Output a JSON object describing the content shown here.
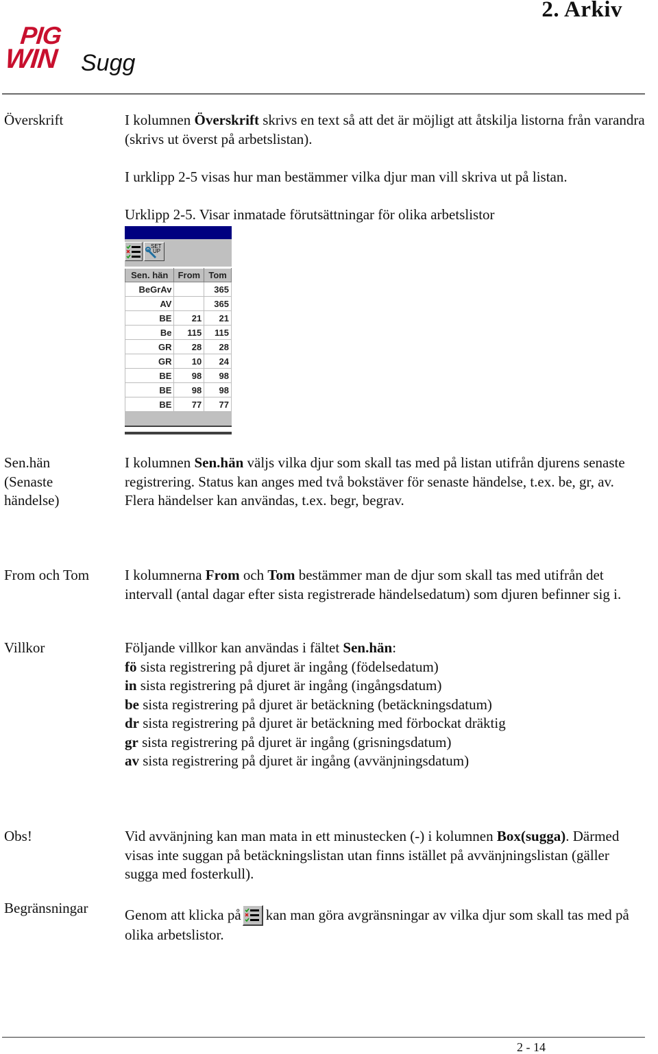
{
  "header": {
    "chapter_title": "2. Arkiv",
    "logo": {
      "line1": "PIG",
      "line2": "WIN",
      "product": "Sugg",
      "brand_color": "#c8102e"
    }
  },
  "sections": {
    "overskrift": {
      "label": "Överskrift",
      "para_pre": "I kolumnen ",
      "para_bold": "Överskrift",
      "para_post": " skrivs en text så att det är möjligt att åtskilja listorna från varandra (skrivs ut överst på arbetslistan).",
      "para2": "I urklipp 2-5 visas hur man bestämmer vilka djur man vill skriva ut på listan.",
      "caption": "Urklipp 2-5. Visar inmatade förutsättningar för olika arbetslistor"
    },
    "senhan": {
      "label_line1": "Sen.hän",
      "label_line2": "(Senaste",
      "label_line3": "händelse)",
      "para_pre": "I kolumnen ",
      "para_bold": "Sen.hän",
      "para_post": " väljs vilka djur som skall tas med på listan utifrån djurens senaste registrering. Status kan anges med två bokstäver för senaste händelse, t.ex. be, gr, av. Flera händelser kan användas, t.ex. begr, begrav."
    },
    "fromtom": {
      "label": "From och Tom",
      "para_pre": "I kolumnerna ",
      "bold1": "From",
      "mid": " och ",
      "bold2": "Tom",
      "para_post": " bestämmer man de djur som skall tas med utifrån det intervall (antal dagar efter sista registrerade händelsedatum) som djuren befinner sig i."
    },
    "villkor": {
      "label": "Villkor",
      "intro_pre": "Följande villkor kan användas i fältet ",
      "intro_bold": "Sen.hän",
      "intro_post": ":",
      "conditions": [
        {
          "code": "fö",
          "text": " sista registrering på djuret är ingång (födelsedatum)"
        },
        {
          "code": "in",
          "text": " sista registrering på djuret är ingång (ingångsdatum)"
        },
        {
          "code": "be",
          "text": " sista registrering på djuret är betäckning (betäckningsdatum)"
        },
        {
          "code": "dr",
          "text": " sista registrering på djuret är betäckning med förbockat dräktig"
        },
        {
          "code": "gr",
          "text": " sista registrering på djuret är ingång (grisningsdatum)"
        },
        {
          "code": "av",
          "text": " sista registrering på djuret är ingång (avvänjningsdatum)"
        }
      ]
    },
    "obs": {
      "label": "Obs!",
      "para_pre": "Vid avvänjning kan man mata in ett minustecken (-) i kolumnen ",
      "para_bold": "Box(sugga)",
      "para_post": ". Därmed visas inte suggan på betäckningslistan utan finns istället på avvänjningslistan (gäller sugga med fosterkull)."
    },
    "begransningar": {
      "label": "Begränsningar",
      "para_pre": "Genom att klicka på",
      "icon": "criteria-list-icon",
      "para_post": "kan man göra avgränsningar av vilka djur som skall tas med på olika arbetslistor."
    }
  },
  "clip": {
    "toolbar": {
      "button1_icon": "criteria-list-icon",
      "button2_icon": "setup-wrench-icon",
      "button2_text": "SET UP"
    },
    "columns": [
      "Sen. hän",
      "From",
      "Tom"
    ],
    "rows": [
      {
        "senhan": "BeGrAv",
        "from": "",
        "tom": "365"
      },
      {
        "senhan": "AV",
        "from": "",
        "tom": "365"
      },
      {
        "senhan": "BE",
        "from": "21",
        "tom": "21"
      },
      {
        "senhan": "Be",
        "from": "115",
        "tom": "115"
      },
      {
        "senhan": "GR",
        "from": "28",
        "tom": "28"
      },
      {
        "senhan": "GR",
        "from": "10",
        "tom": "24"
      },
      {
        "senhan": "BE",
        "from": "98",
        "tom": "98"
      },
      {
        "senhan": "BE",
        "from": "98",
        "tom": "98"
      },
      {
        "senhan": "BE",
        "from": "77",
        "tom": "77"
      }
    ]
  },
  "footer": {
    "page_number": "2 - 14"
  }
}
